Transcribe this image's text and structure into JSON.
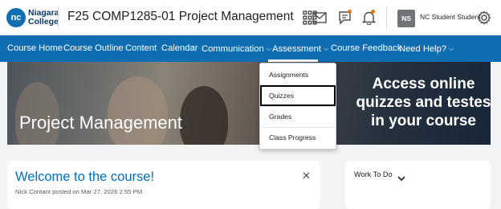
{
  "header": {
    "logo_initials": "nc",
    "logo_line1": "Niagara",
    "logo_line2": "College",
    "course_title": "F25 COMP1285-01 Project Management",
    "user_initials": "NS",
    "user_name": "NC Student Student",
    "icons": [
      "apps-grid-icon",
      "mail-icon",
      "chat-icon",
      "bell-icon",
      "gear-icon"
    ],
    "notification_color": "#e87511"
  },
  "navbar": {
    "items": [
      {
        "label": "Course Home"
      },
      {
        "label": "Course Outline"
      },
      {
        "label": "Content"
      },
      {
        "label": "Calendar"
      },
      {
        "label": "Communication",
        "has_dropdown": true
      },
      {
        "label": "Assessment",
        "has_dropdown": true,
        "open": true
      },
      {
        "label": "Course Feedback"
      },
      {
        "label": "Need Help?",
        "has_dropdown": true
      }
    ],
    "background": "#0f6eb2"
  },
  "dropdown": {
    "items": [
      {
        "label": "Assignments"
      },
      {
        "label": "Quizzes",
        "focused": true
      },
      {
        "label": "Grades"
      },
      {
        "label": "Class Progress"
      }
    ]
  },
  "banner": {
    "title": "Project Management",
    "promo": "Access online quizzes and testes in your course"
  },
  "announcement": {
    "title": "Welcome to the course!",
    "meta": "Nick Contant posted on Mar 27, 2026 2:55 PM"
  },
  "work_to_do": {
    "title": "Work To Do"
  }
}
